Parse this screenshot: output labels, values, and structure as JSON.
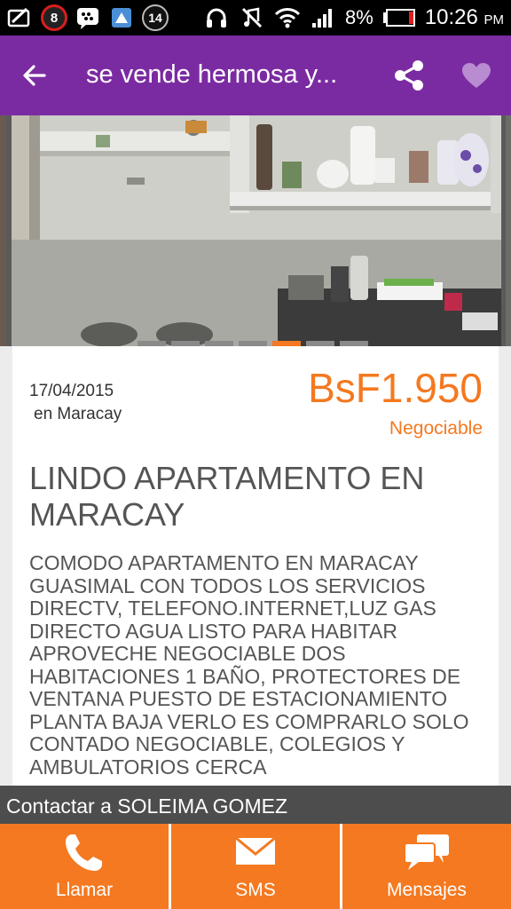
{
  "status_bar": {
    "notification_badge_1": "8",
    "notification_badge_2": "14",
    "battery_percent": "8%",
    "time": "10:26",
    "time_suffix": "PM",
    "icons": [
      "notification-card-icon",
      "messenger-icon",
      "app-icon",
      "headphones-icon",
      "mute-icon",
      "wifi-icon",
      "signal-icon",
      "battery-icon"
    ]
  },
  "toolbar": {
    "title": "se vende hermosa y...",
    "back_icon": "arrow-left-icon",
    "share_icon": "share-icon",
    "favorite_icon": "heart-icon",
    "color": "#7b2ba2"
  },
  "gallery": {
    "image_count": 6,
    "active_index": 4
  },
  "listing": {
    "date": "17/04/2015",
    "location": "en Maracay",
    "price": "BsF1.950",
    "negotiable": "Negociable",
    "title": "LINDO APARTAMENTO EN MARACAY",
    "description": "COMODO APARTAMENTO EN MARACAY GUASIMAL CON TODOS LOS SERVICIOS DIRECTV, TELEFONO.INTERNET,LUZ GAS DIRECTO AGUA LISTO PARA HABITAR APROVECHE NEGOCIABLE DOS HABITACIONES 1 BAÑO, PROTECTORES DE VENTANA PUESTO DE ESTACIONAMIENTO PLANTA BAJA VERLO ES COMPRARLO SOLO CONTADO NEGOCIABLE, COLEGIOS Y AMBULATORIOS CERCA",
    "accent": "#f47920"
  },
  "contact": {
    "label": "Contactar a SOLEIMA GOMEZ"
  },
  "actions": [
    {
      "label": "Llamar",
      "icon": "phone-icon"
    },
    {
      "label": "SMS",
      "icon": "envelope-icon"
    },
    {
      "label": "Mensajes",
      "icon": "chat-bubbles-icon"
    }
  ]
}
